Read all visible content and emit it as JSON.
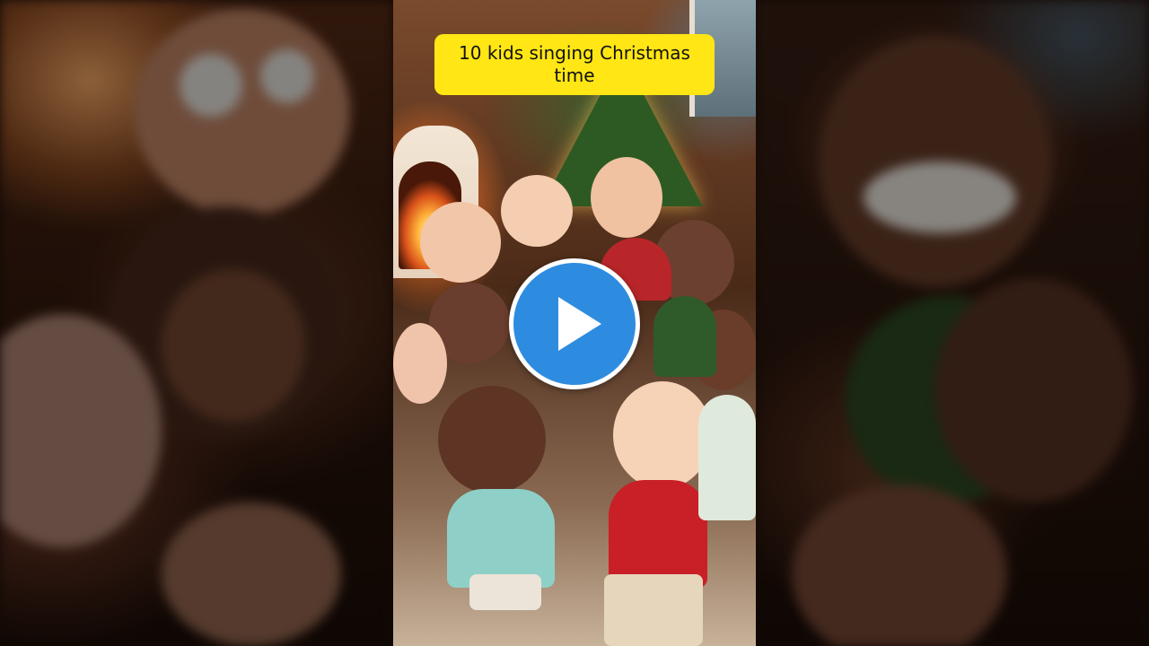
{
  "video": {
    "title_overlay": "10 kids singing Christmas time",
    "play_button_icon": "play-icon",
    "accent_color": "#2e8ce0",
    "badge_color": "#ffe614"
  }
}
